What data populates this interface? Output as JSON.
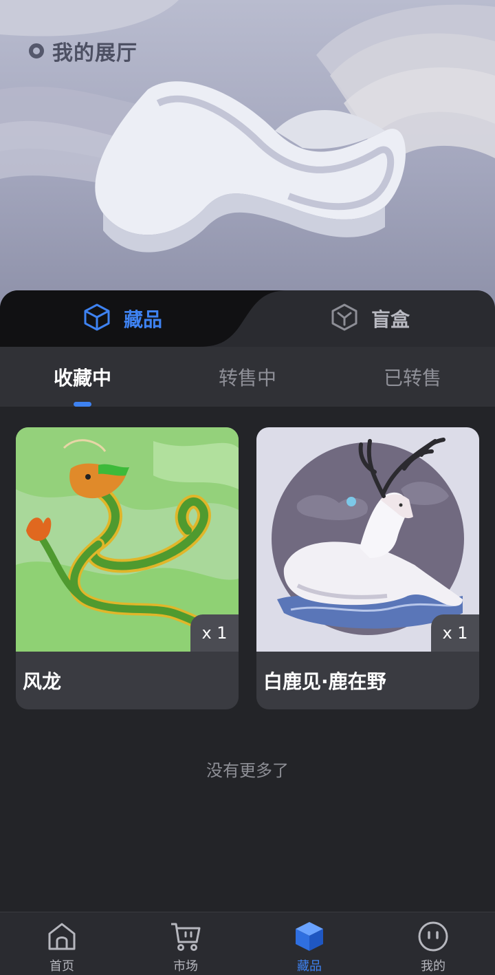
{
  "hero": {
    "title": "我的展厅"
  },
  "top_tabs": [
    {
      "label": "藏品",
      "icon": "cube-icon",
      "active": true
    },
    {
      "label": "盲盒",
      "icon": "hexagon-box-icon",
      "active": false
    }
  ],
  "sub_tabs": [
    {
      "label": "收藏中",
      "active": true
    },
    {
      "label": "转售中",
      "active": false
    },
    {
      "label": "已转售",
      "active": false
    }
  ],
  "collection": [
    {
      "name": "风龙",
      "quantity": "x 1",
      "image": "dragon-artwork"
    },
    {
      "name": "白鹿见·鹿在野",
      "quantity": "x 1",
      "image": "white-deer-artwork"
    }
  ],
  "footer_text": "没有更多了",
  "bottom_nav": [
    {
      "label": "首页",
      "icon": "home-icon",
      "active": false
    },
    {
      "label": "市场",
      "icon": "cart-icon",
      "active": false
    },
    {
      "label": "藏品",
      "icon": "cube-icon",
      "active": true
    },
    {
      "label": "我的",
      "icon": "face-icon",
      "active": false
    }
  ],
  "colors": {
    "accent": "#3e82f1",
    "background": "#232428",
    "card": "#3a3b41"
  }
}
